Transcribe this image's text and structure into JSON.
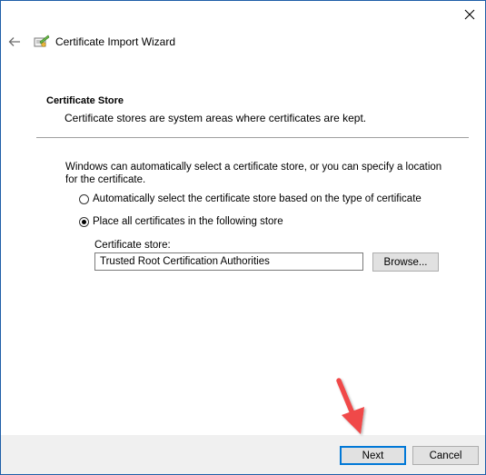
{
  "window": {
    "title": "Certificate Import Wizard"
  },
  "icons": {
    "close": "close-icon",
    "back": "back-arrow-icon",
    "wizard": "certificate-wizard-icon"
  },
  "section": {
    "heading": "Certificate Store",
    "description": "Certificate stores are system areas where certificates are kept."
  },
  "body": {
    "intro": "Windows can automatically select a certificate store, or you can specify a location for the certificate."
  },
  "options": [
    {
      "label": "Automatically select the certificate store based on the type of certificate",
      "checked": false
    },
    {
      "label": "Place all certificates in the following store",
      "checked": true
    }
  ],
  "store": {
    "label": "Certificate store:",
    "value": "Trusted Root Certification Authorities",
    "browse_label": "Browse..."
  },
  "footer": {
    "next_label": "Next",
    "cancel_label": "Cancel"
  },
  "colors": {
    "window_border": "#1f5fa8",
    "footer_bg": "#f0f0f0",
    "button_bg": "#e1e1e1",
    "default_button_border": "#0078d7",
    "annotation_arrow": "#f04848"
  }
}
